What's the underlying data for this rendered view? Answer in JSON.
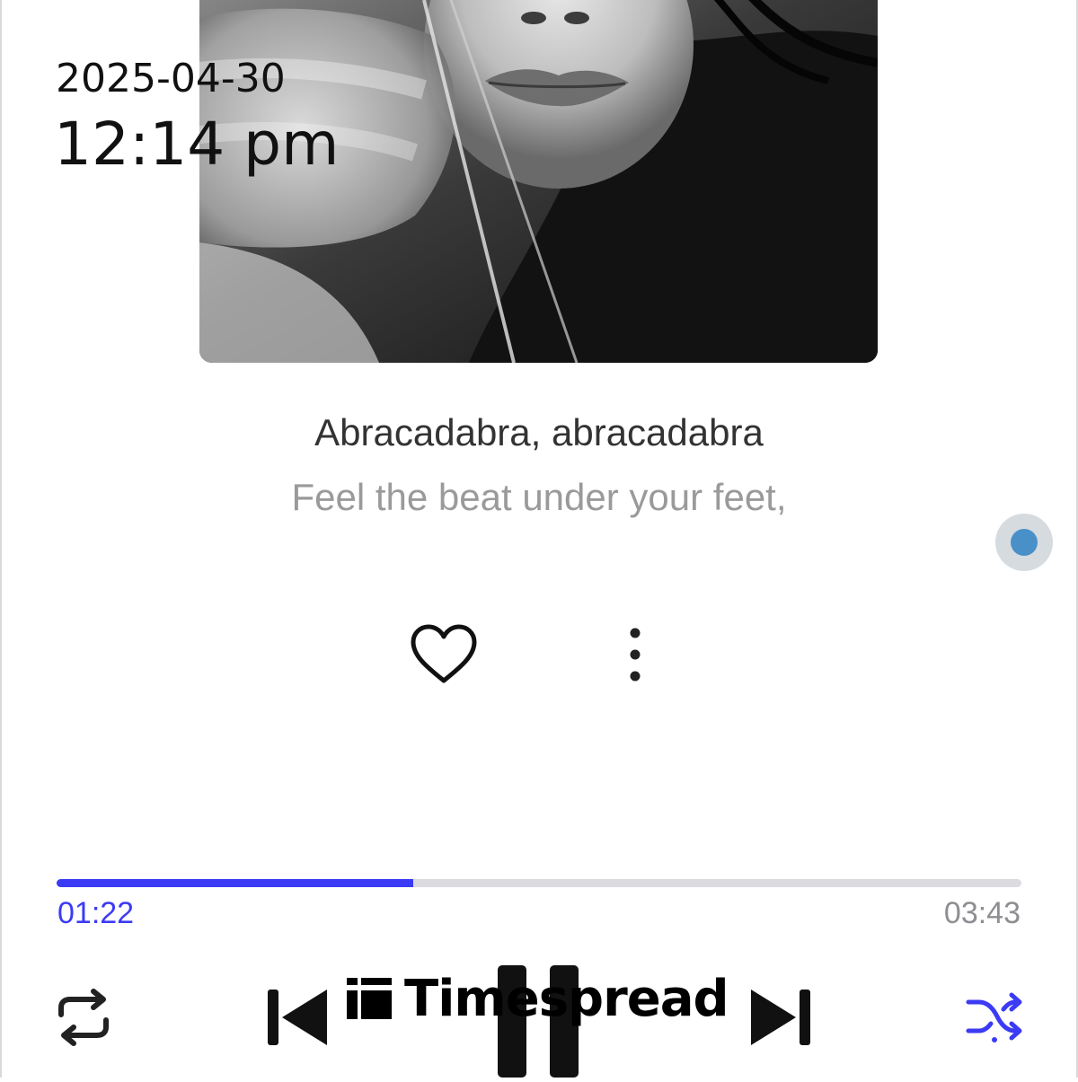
{
  "overlay": {
    "date": "2025-04-30",
    "time": "12:14 pm"
  },
  "lyrics": {
    "current": "Abracadabra, abracadabra",
    "next": "Feel the beat under your feet,"
  },
  "playback": {
    "elapsed": "01:22",
    "total": "03:43",
    "progress_percent": 37
  },
  "icons": {
    "like": "heart-icon",
    "more": "more-vertical-icon",
    "repeat": "repeat-icon",
    "previous": "skip-previous-icon",
    "pause": "pause-icon",
    "next": "skip-next-icon",
    "shuffle": "shuffle-icon"
  },
  "colors": {
    "accent": "#3b3bf5",
    "lyric_current": "#333333",
    "lyric_next": "#9a9a9a",
    "track": "#dcdce0",
    "assistive_dot": "#4a90c8"
  },
  "watermark": {
    "text": "Timespread"
  }
}
